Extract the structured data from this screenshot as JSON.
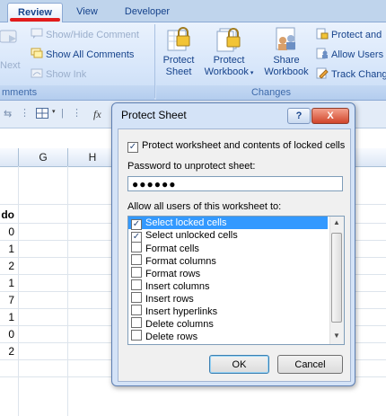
{
  "tabs": [
    {
      "label": "Review",
      "active": true
    },
    {
      "label": "View",
      "active": false
    },
    {
      "label": "Developer",
      "active": false
    }
  ],
  "comments_group": {
    "caption": "mments",
    "next_label": "Next",
    "show_hide_label": "Show/Hide Comment",
    "show_all_label": "Show All Comments",
    "show_ink_label": "Show Ink"
  },
  "changes_group": {
    "caption": "Changes",
    "protect_sheet": [
      "Protect",
      "Sheet"
    ],
    "protect_workbook": [
      "Protect",
      "Workbook"
    ],
    "share_workbook": [
      "Share",
      "Workbook"
    ],
    "protect_and_share": "Protect and",
    "allow_users": "Allow Users",
    "track_changes": "Track Chang"
  },
  "formula_bar": {
    "fx": "fx"
  },
  "columns": [
    "G",
    "H"
  ],
  "cells": {
    "header_fragment": "do",
    "values": [
      "0",
      "1",
      "2",
      "1",
      "7",
      "1",
      "0",
      "2"
    ]
  },
  "dialog": {
    "title": "Protect Sheet",
    "help": "?",
    "close": "X",
    "protect_checkbox_label": "Protect worksheet and contents of locked cells",
    "protect_checked": true,
    "password_label": "Password to unprotect sheet:",
    "password_value": "●●●●●●",
    "allow_label": "Allow all users of this worksheet to:",
    "permissions": [
      {
        "label": "Select locked cells",
        "checked": true,
        "selected": true
      },
      {
        "label": "Select unlocked cells",
        "checked": true,
        "selected": false
      },
      {
        "label": "Format cells",
        "checked": false,
        "selected": false
      },
      {
        "label": "Format columns",
        "checked": false,
        "selected": false
      },
      {
        "label": "Format rows",
        "checked": false,
        "selected": false
      },
      {
        "label": "Insert columns",
        "checked": false,
        "selected": false
      },
      {
        "label": "Insert rows",
        "checked": false,
        "selected": false
      },
      {
        "label": "Insert hyperlinks",
        "checked": false,
        "selected": false
      },
      {
        "label": "Delete columns",
        "checked": false,
        "selected": false
      },
      {
        "label": "Delete rows",
        "checked": false,
        "selected": false
      }
    ],
    "ok_label": "OK",
    "cancel_label": "Cancel"
  },
  "colors": {
    "highlight_red": "#e21b1b",
    "selection_blue": "#3399ff",
    "ribbon_text": "#15428b"
  }
}
